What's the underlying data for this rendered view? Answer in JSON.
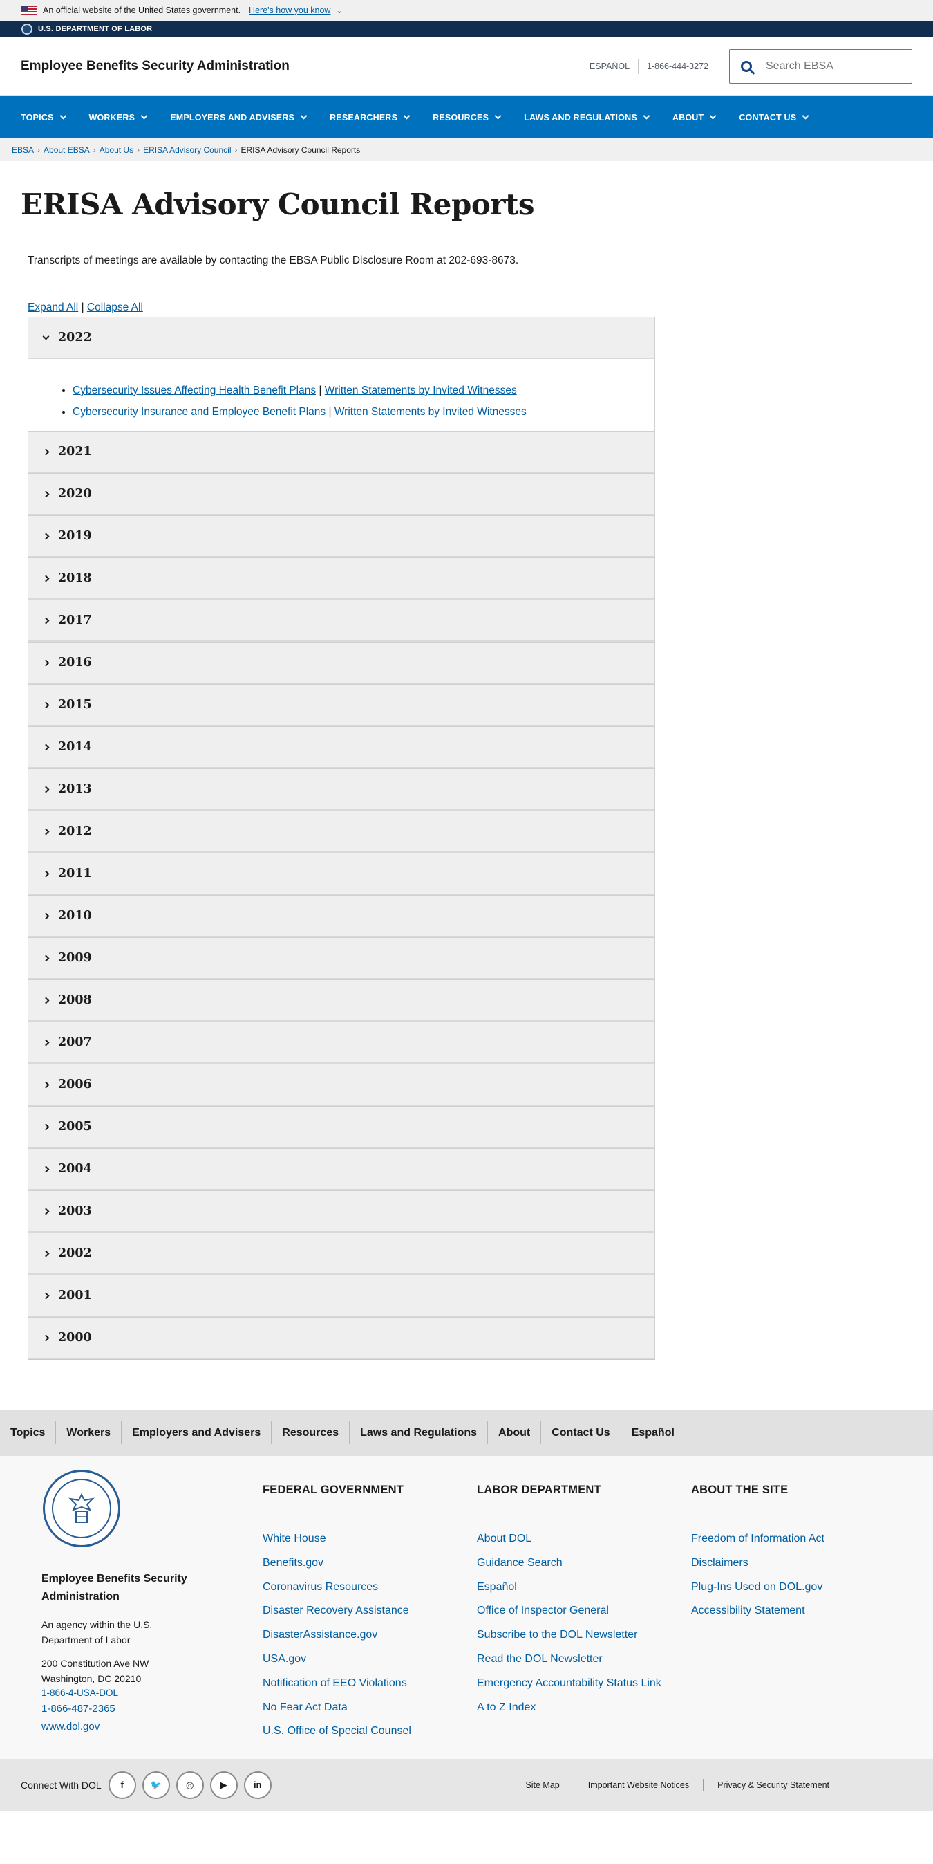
{
  "gov_banner": {
    "text": "An official website of the United States government.",
    "link": "Here's how you know"
  },
  "dept_bar": {
    "text": "U.S. DEPARTMENT OF LABOR"
  },
  "header": {
    "agency_name": "Employee Benefits Security Administration",
    "espanol": "ESPAÑOL",
    "phone": "1-866-444-3272",
    "search_placeholder": "Search EBSA"
  },
  "nav": [
    "Topics",
    "Workers",
    "Employers and Advisers",
    "Researchers",
    "Resources",
    "Laws and Regulations",
    "About",
    "Contact Us"
  ],
  "breadcrumb": {
    "items": [
      "EBSA",
      "About EBSA",
      "About Us",
      "ERISA Advisory Council"
    ],
    "current": "ERISA Advisory Council Reports"
  },
  "page": {
    "title": "ERISA Advisory Council Reports",
    "intro": "Transcripts of meetings are available by contacting the EBSA Public Disclosure Room at 202-693-8673.",
    "expand_all": "Expand All",
    "collapse_all": "Collapse All",
    "divider": "|"
  },
  "accordion": {
    "open_year": "2022",
    "open_items": [
      {
        "title": "Cybersecurity Issues Affecting Health Benefit Plans",
        "statements": "Written Statements by Invited Witnesses"
      },
      {
        "title": "Cybersecurity Insurance and Employee Benefit Plans",
        "statements": "Written Statements by Invited Witnesses"
      }
    ],
    "closed_years": [
      "2021",
      "2020",
      "2019",
      "2018",
      "2017",
      "2016",
      "2015",
      "2014",
      "2013",
      "2012",
      "2011",
      "2010",
      "2009",
      "2008",
      "2007",
      "2006",
      "2005",
      "2004",
      "2003",
      "2002",
      "2001",
      "2000"
    ]
  },
  "footer_nav": [
    "Topics",
    "Workers",
    "Employers and Advisers",
    "Resources",
    "Laws and Regulations",
    "About",
    "Contact Us",
    "Español"
  ],
  "footer": {
    "agency_name": "Employee Benefits Security Administration",
    "agency_desc": "An agency within the U.S. Department of Labor",
    "address_line1": "200 Constitution Ave NW",
    "address_line2": "Washington, DC 20210",
    "phone1": "1-866-4-USA-DOL",
    "phone2": "1-866-487-2365",
    "website": "www.dol.gov",
    "columns": [
      {
        "heading": "FEDERAL GOVERNMENT",
        "links": [
          "White House",
          "Benefits.gov",
          "Coronavirus Resources",
          "Disaster Recovery Assistance",
          "DisasterAssistance.gov",
          "USA.gov",
          "Notification of EEO Violations",
          "No Fear Act Data",
          "U.S. Office of Special Counsel"
        ]
      },
      {
        "heading": "LABOR DEPARTMENT",
        "links": [
          "About DOL",
          "Guidance Search",
          "Español",
          "Office of Inspector General",
          "Subscribe to the DOL Newsletter",
          "Read the DOL Newsletter",
          "Emergency Accountability Status Link",
          "A to Z Index"
        ]
      },
      {
        "heading": "ABOUT THE SITE",
        "links": [
          "Freedom of Information Act",
          "Disclaimers",
          "Plug-Ins Used on DOL.gov",
          "Accessibility Statement"
        ]
      }
    ]
  },
  "social": {
    "label": "Connect With DOL",
    "icons": [
      "facebook-icon",
      "twitter-icon",
      "instagram-icon",
      "youtube-icon",
      "linkedin-icon"
    ],
    "glyphs": [
      "f",
      "🐦",
      "◎",
      "▶",
      "in"
    ]
  },
  "legal": [
    "Site Map",
    "Important Website Notices",
    "Privacy & Security Statement"
  ],
  "colors": {
    "nav_blue": "#0071bc",
    "dept_navy": "#112e51",
    "link": "#005ea2"
  }
}
